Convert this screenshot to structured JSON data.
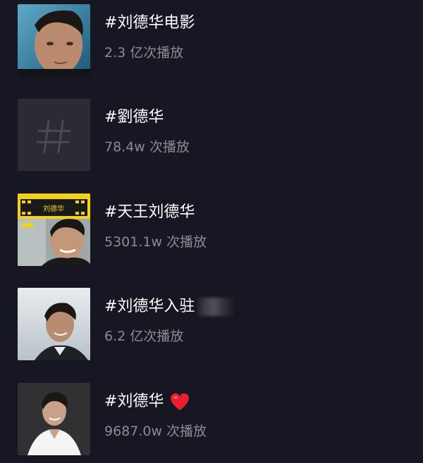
{
  "topics": [
    {
      "title": "#刘德华电影",
      "plays": "2.3 亿次播放",
      "thumb_icon": "portrait-thumb-icon",
      "emoji": null
    },
    {
      "title": "#劉德华",
      "plays": "78.4w 次播放",
      "thumb_icon": "hashtag-placeholder-icon",
      "emoji": null
    },
    {
      "title": "#天王刘德华",
      "plays": "5301.1w 次播放",
      "thumb_icon": "poster-thumb-icon",
      "thumb_poster_text": "刘德华",
      "emoji": null
    },
    {
      "title": "#刘德华入驻",
      "plays": "6.2 亿次播放",
      "thumb_icon": "portrait-thumb-icon",
      "emoji": null,
      "redacted": true
    },
    {
      "title": "#刘德华",
      "plays": "9687.0w 次播放",
      "thumb_icon": "portrait-thumb-icon",
      "emoji": "heart-icon"
    }
  ],
  "colors": {
    "background": "#161722",
    "title": "#ffffff",
    "secondary": "#8a8b93",
    "placeholder_tile": "#2a2b35",
    "heart": "#e8202e"
  }
}
